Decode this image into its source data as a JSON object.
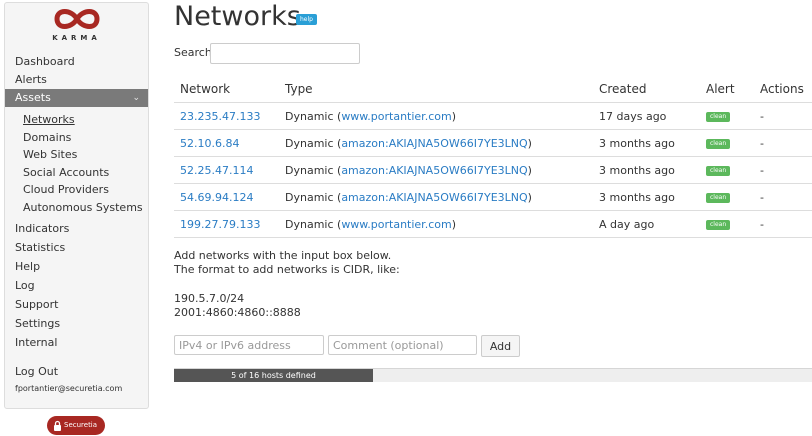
{
  "brand": {
    "logo_text": "KARMA",
    "footer_badge": "Securetia",
    "brand_color": "#a82822"
  },
  "sidebar": {
    "items": [
      {
        "label": "Dashboard"
      },
      {
        "label": "Alerts"
      },
      {
        "label": "Assets",
        "active": true
      },
      {
        "label": "Indicators"
      },
      {
        "label": "Statistics"
      },
      {
        "label": "Help"
      },
      {
        "label": "Log"
      },
      {
        "label": "Support"
      },
      {
        "label": "Settings"
      },
      {
        "label": "Internal"
      },
      {
        "label": "Log Out"
      }
    ],
    "sub_items": [
      {
        "label": "Networks",
        "current": true
      },
      {
        "label": "Domains"
      },
      {
        "label": "Web Sites"
      },
      {
        "label": "Social Accounts"
      },
      {
        "label": "Cloud Providers"
      },
      {
        "label": "Autonomous Systems"
      }
    ],
    "user_email": "fportantier@securetia.com"
  },
  "main": {
    "title": "Networks",
    "help_badge": "help",
    "search": {
      "label": "Search:",
      "value": ""
    },
    "table": {
      "headers": [
        "Network",
        "Type",
        "Created",
        "Alert",
        "Actions"
      ],
      "rows": [
        {
          "network": "23.235.47.133",
          "type_prefix": "Dynamic (",
          "type_link": "www.portantier.com",
          "type_suffix": ")",
          "created": "17 days ago",
          "alert": "clean",
          "actions": "-"
        },
        {
          "network": "52.10.6.84",
          "type_prefix": "Dynamic (",
          "type_link": "amazon:AKIAJNA5OW66I7YE3LNQ",
          "type_suffix": ")",
          "created": "3 months ago",
          "alert": "clean",
          "actions": "-"
        },
        {
          "network": "52.25.47.114",
          "type_prefix": "Dynamic (",
          "type_link": "amazon:AKIAJNA5OW66I7YE3LNQ",
          "type_suffix": ")",
          "created": "3 months ago",
          "alert": "clean",
          "actions": "-"
        },
        {
          "network": "54.69.94.124",
          "type_prefix": "Dynamic (",
          "type_link": "amazon:AKIAJNA5OW66I7YE3LNQ",
          "type_suffix": ")",
          "created": "3 months ago",
          "alert": "clean",
          "actions": "-"
        },
        {
          "network": "199.27.79.133",
          "type_prefix": "Dynamic (",
          "type_link": "www.portantier.com",
          "type_suffix": ")",
          "created": "A day ago",
          "alert": "clean",
          "actions": "-"
        }
      ]
    },
    "info": {
      "line1": "Add networks with the input box below.",
      "line2": "The format to add networks is CIDR, like:",
      "example1": "190.5.7.0/24",
      "example2": "2001:4860:4860::8888"
    },
    "form": {
      "address_placeholder": "IPv4 or IPv6 address",
      "comment_placeholder": "Comment (optional)",
      "add_label": "Add"
    },
    "progress": {
      "text": "5 of 16 hosts defined",
      "fraction": 0.3125
    }
  },
  "colors": {
    "link": "#2a7cc4",
    "active_nav": "#7a7a7a",
    "clean_badge": "#5cb85c",
    "help_badge": "#2a9fd6"
  }
}
